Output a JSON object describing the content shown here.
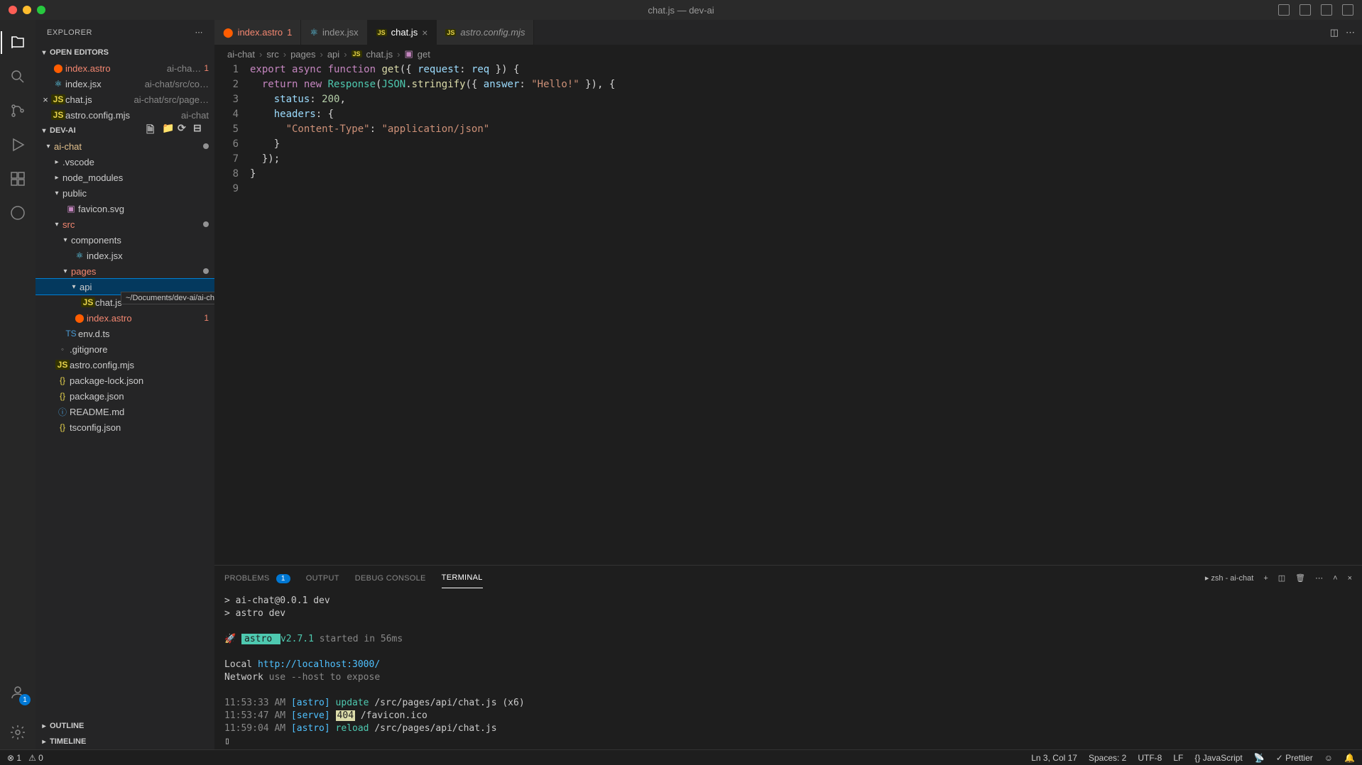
{
  "window": {
    "title": "chat.js — dev-ai"
  },
  "activity": {
    "account_badge": "1"
  },
  "explorer": {
    "title": "EXPLORER",
    "sections": {
      "open_editors": "OPEN EDITORS",
      "project": "DEV-AI",
      "outline": "OUTLINE",
      "timeline": "TIMELINE"
    },
    "open_editors": [
      {
        "name": "index.astro",
        "hint": "ai-cha…",
        "badge": "1",
        "icon": "astro"
      },
      {
        "name": "index.jsx",
        "hint": "ai-chat/src/co…",
        "icon": "react"
      },
      {
        "name": "chat.js",
        "hint": "ai-chat/src/page…",
        "icon": "js",
        "close": true
      },
      {
        "name": "astro.config.mjs",
        "hint": "ai-chat",
        "icon": "js"
      }
    ],
    "tree": {
      "root": "ai-chat",
      "vscode": ".vscode",
      "node_modules": "node_modules",
      "public": "public",
      "favicon": "favicon.svg",
      "src": "src",
      "components": "components",
      "index_jsx": "index.jsx",
      "pages": "pages",
      "api": "api",
      "api_tooltip": "~/Documents/dev-ai/ai-chat/src/pages/api",
      "chat_js": "chat.js",
      "index_astro": "index.astro",
      "index_astro_badge": "1",
      "env": "env.d.ts",
      "gitignore": ".gitignore",
      "astro_config": "astro.config.mjs",
      "pkg_lock": "package-lock.json",
      "pkg": "package.json",
      "readme": "README.md",
      "tsconfig": "tsconfig.json"
    }
  },
  "tabs": [
    {
      "name": "index.astro",
      "badge": "1",
      "icon": "astro"
    },
    {
      "name": "index.jsx",
      "icon": "react"
    },
    {
      "name": "chat.js",
      "icon": "js",
      "active": true,
      "close": true
    },
    {
      "name": "astro.config.mjs",
      "icon": "js",
      "italic": true
    }
  ],
  "breadcrumbs": [
    "ai-chat",
    "src",
    "pages",
    "api",
    "chat.js",
    "get"
  ],
  "code": {
    "lines": [
      "1",
      "2",
      "3",
      "4",
      "5",
      "6",
      "7",
      "8",
      "9"
    ]
  },
  "panel": {
    "tabs": {
      "problems": "PROBLEMS",
      "problems_count": "1",
      "output": "OUTPUT",
      "debug": "DEBUG CONSOLE",
      "terminal": "TERMINAL"
    },
    "shell": "zsh - ai-chat",
    "terminal": {
      "l1": "> ai-chat@0.0.1 dev",
      "l2": "> astro dev",
      "rocket": "🚀",
      "astro_label": " astro ",
      "version": "v2.7.1",
      "started": "started in 56ms",
      "local_label": "Local",
      "local_url": "http://localhost:3000/",
      "network_label": "Network",
      "network_hint": "use --host to expose",
      "t1": "11:53:33 AM",
      "t2": "11:53:47 AM",
      "t3": "11:59:04 AM",
      "astro_tag": "[astro]",
      "update": "update",
      "serve": "[serve]",
      "code404": "404",
      "reload": "reload",
      "path1": "/src/pages/api/chat.js (x6)",
      "path2": "/favicon.ico",
      "path3": "/src/pages/api/chat.js"
    }
  },
  "status": {
    "errors": "1",
    "warnings": "0",
    "cursor": "Ln 3, Col 17",
    "spaces": "Spaces: 2",
    "encoding": "UTF-8",
    "eol": "LF",
    "lang": "JavaScript",
    "prettier": "Prettier"
  }
}
